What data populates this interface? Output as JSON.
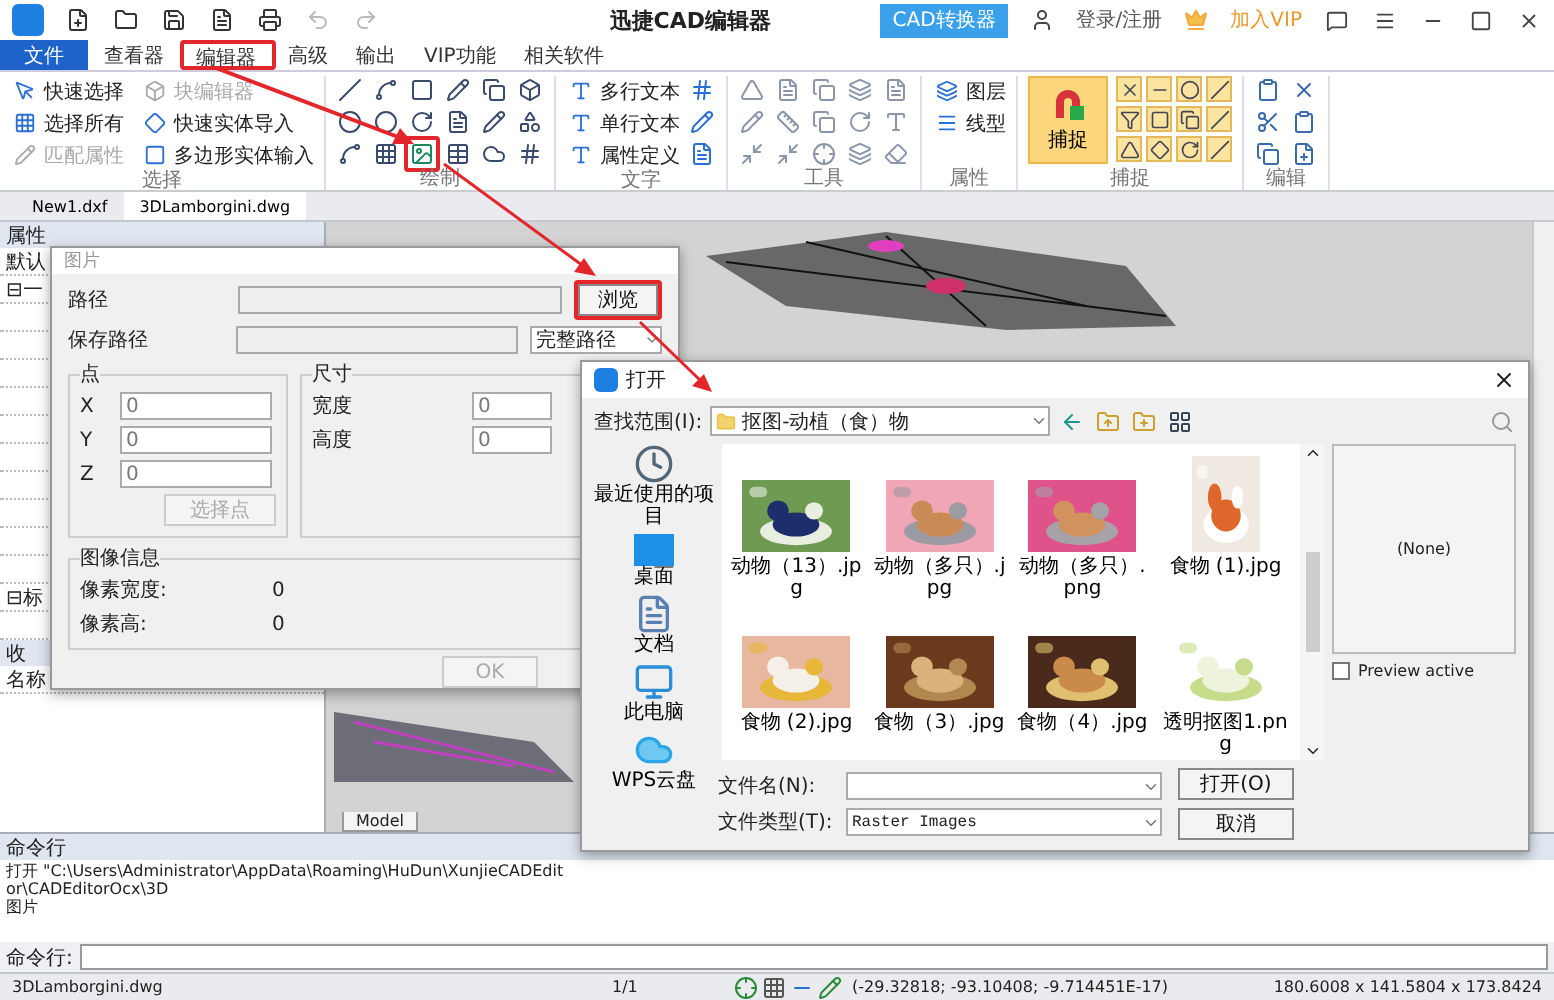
{
  "title_bar": {
    "title": "迅捷CAD编辑器",
    "converter_button": "CAD转换器",
    "login": "登录/注册",
    "vip": "加入VIP"
  },
  "menu_tabs": [
    {
      "label": "文件",
      "kind": "file",
      "selected": false
    },
    {
      "label": "查看器",
      "kind": "tab",
      "selected": false
    },
    {
      "label": "编辑器",
      "kind": "tab",
      "selected": true
    },
    {
      "label": "高级",
      "kind": "tab",
      "selected": false
    },
    {
      "label": "输出",
      "kind": "tab",
      "selected": false
    },
    {
      "label": "VIP功能",
      "kind": "tab",
      "selected": false
    },
    {
      "label": "相关软件",
      "kind": "tab",
      "selected": false
    }
  ],
  "ribbon": {
    "select_group": {
      "title": "选择",
      "items": [
        {
          "label": "快速选择",
          "disabled": false
        },
        {
          "label": "块编辑器",
          "disabled": true
        },
        {
          "label": "选择所有",
          "disabled": false
        },
        {
          "label": "快速实体导入",
          "disabled": false
        },
        {
          "label": "匹配属性",
          "disabled": true
        },
        {
          "label": "多边形实体输入",
          "disabled": false
        }
      ]
    },
    "draw_group": {
      "title": "绘制"
    },
    "text_group": {
      "title": "文字",
      "items": [
        {
          "label": "多行文本"
        },
        {
          "label": "单行文本"
        },
        {
          "label": "属性定义"
        }
      ]
    },
    "tools_group": {
      "title": "工具"
    },
    "properties_group": {
      "title": "属性",
      "items": [
        {
          "label": "图层"
        },
        {
          "label": "线型"
        }
      ]
    },
    "snap_group": {
      "title": "捕捉",
      "snap_button": "捕捉"
    },
    "edit_group": {
      "title": "编辑"
    }
  },
  "document_tabs": [
    {
      "label": "New1.dxf",
      "selected": false
    },
    {
      "label": "3DLamborgini.dwg",
      "selected": true
    }
  ],
  "properties_panel": {
    "title": "属性",
    "header_cell": "默认",
    "tree_rows": [
      "⊟一",
      "⊟标"
    ]
  },
  "favorites_panel": {
    "title": "收",
    "column": "名称"
  },
  "canvas": {
    "layout_tab": "Model"
  },
  "image_dialog": {
    "title": "图片",
    "path_label": "路径",
    "browse_button": "浏览",
    "save_path_label": "保存路径",
    "save_path_mode": "完整路径",
    "point_group": {
      "title": "点",
      "fields": [
        {
          "label": "X",
          "value": "0"
        },
        {
          "label": "Y",
          "value": "0"
        },
        {
          "label": "Z",
          "value": "0"
        }
      ],
      "pick_button": {
        "label": "选择点",
        "disabled": true
      }
    },
    "size_group": {
      "title": "尺寸",
      "fields": [
        {
          "label": "宽度",
          "value": "0"
        },
        {
          "label": "高度",
          "value": "0"
        }
      ]
    },
    "info_group": {
      "title": "图像信息",
      "rows": [
        {
          "label": "像素宽度:",
          "value": "0"
        },
        {
          "label": "像素高:",
          "value": "0"
        }
      ]
    },
    "ok_button": {
      "label": "OK",
      "disabled": true
    }
  },
  "open_dialog": {
    "title": "打开",
    "look_in_label": "查找范围(I):",
    "look_in_value": "抠图-动植（食）物",
    "places": [
      {
        "label": "最近使用的项目",
        "kind": "recent"
      },
      {
        "label": "桌面",
        "kind": "desktop"
      },
      {
        "label": "文档",
        "kind": "documents"
      },
      {
        "label": "此电脑",
        "kind": "computer"
      },
      {
        "label": "WPS云盘",
        "kind": "cloud"
      }
    ],
    "files": [
      {
        "name": "动物（13）.jpg"
      },
      {
        "name": "动物（多只）.jpg"
      },
      {
        "name": "动物（多只）.png"
      },
      {
        "name": "食物 (1).jpg"
      },
      {
        "name": "食物 (2).jpg"
      },
      {
        "name": "食物（3）.jpg"
      },
      {
        "name": "食物（4）.jpg"
      },
      {
        "name": "透明抠图1.png"
      }
    ],
    "preview": {
      "text": "(None)",
      "active_label": "Preview active",
      "checked": false
    },
    "file_name_label": "文件名(N):",
    "file_type_label": "文件类型(T):",
    "file_type_value": "Raster Images",
    "open_button": "打开(O)",
    "cancel_button": "取消"
  },
  "command_panel": {
    "title": "命令行",
    "history": [
      "打开 \"C:\\Users\\Administrator\\AppData\\Roaming\\HuDun\\XunjieCADEditor\\CADEditorOcx\\3D",
      "图片"
    ],
    "prompt": "命令行:"
  },
  "status_bar": {
    "file": "3DLamborgini.dwg",
    "page": "1/1",
    "coordinates": "(-29.32818; -93.10408; -9.714451E-17)",
    "extents": "180.6008 x 141.5804 x 173.8424"
  }
}
